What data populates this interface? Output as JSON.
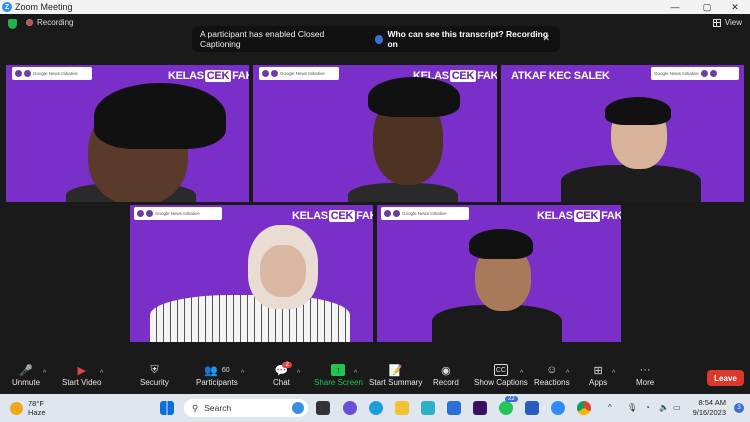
{
  "window": {
    "title": "Zoom Meeting"
  },
  "meeting_bar": {
    "recording_label": "Recording",
    "view_label": "View"
  },
  "banner": {
    "message": "A participant has enabled Closed Captioning",
    "link": "Who can see this transcript? Recording on"
  },
  "tile_brand": {
    "prefix": "KELAS",
    "highlight": "CEK",
    "suffix": "FAKTA",
    "strip_text": "Google News Initiative",
    "mirrored": "ATKAF KEC SALEK"
  },
  "toolbar": {
    "unmute": "Unmute",
    "start_video": "Start Video",
    "security": "Security",
    "participants": "Participants",
    "participants_count": "60",
    "chat": "Chat",
    "chat_badge": "2",
    "share_screen": "Share Screen",
    "start_summary": "Start Summary",
    "record": "Record",
    "show_captions": "Show Captions",
    "reactions": "Reactions",
    "apps": "Apps",
    "more": "More",
    "leave": "Leave"
  },
  "taskbar": {
    "weather_temp": "78°F",
    "weather_cond": "Haze",
    "search_placeholder": "Search",
    "whatsapp_badge": "22",
    "time": "8:54 AM",
    "date": "9/16/2023",
    "notif_count": "3"
  },
  "colors": {
    "tile_purple": "#7b2fc9",
    "leave_red": "#d9392c",
    "share_green": "#23c552"
  }
}
